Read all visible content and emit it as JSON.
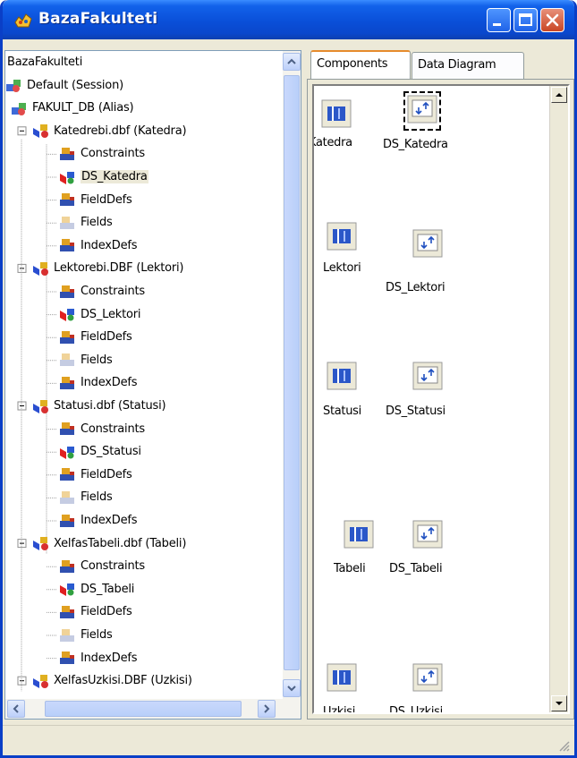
{
  "window": {
    "title": "BazaFakulteti"
  },
  "tree": [
    {
      "label": "BazaFakulteti",
      "level": 0,
      "icon": "none"
    },
    {
      "label": "Default (Session)",
      "level": 0,
      "icon": "session-icon"
    },
    {
      "label": "FAKULT_DB (Alias)",
      "level": 1,
      "icon": "database-icon",
      "expander": "minus"
    },
    {
      "label": "Katedrebi.dbf (Katedra)",
      "level": 2,
      "icon": "table-icon",
      "expander": "minus"
    },
    {
      "label": "Constraints",
      "level": 3,
      "icon": "component-icon"
    },
    {
      "label": "DS_Katedra",
      "level": 3,
      "icon": "datasource-icon",
      "selected": true
    },
    {
      "label": "FieldDefs",
      "level": 3,
      "icon": "component-icon"
    },
    {
      "label": "Fields",
      "level": 3,
      "icon": "component-faded-icon"
    },
    {
      "label": "IndexDefs",
      "level": 3,
      "icon": "component-icon"
    },
    {
      "label": "Lektorebi.DBF (Lektori)",
      "level": 2,
      "icon": "table-icon",
      "expander": "minus"
    },
    {
      "label": "Constraints",
      "level": 3,
      "icon": "component-icon"
    },
    {
      "label": "DS_Lektori",
      "level": 3,
      "icon": "datasource-icon"
    },
    {
      "label": "FieldDefs",
      "level": 3,
      "icon": "component-icon"
    },
    {
      "label": "Fields",
      "level": 3,
      "icon": "component-faded-icon"
    },
    {
      "label": "IndexDefs",
      "level": 3,
      "icon": "component-icon"
    },
    {
      "label": "Statusi.dbf (Statusi)",
      "level": 2,
      "icon": "table-icon",
      "expander": "minus"
    },
    {
      "label": "Constraints",
      "level": 3,
      "icon": "component-icon"
    },
    {
      "label": "DS_Statusi",
      "level": 3,
      "icon": "datasource-icon"
    },
    {
      "label": "FieldDefs",
      "level": 3,
      "icon": "component-icon"
    },
    {
      "label": "Fields",
      "level": 3,
      "icon": "component-faded-icon"
    },
    {
      "label": "IndexDefs",
      "level": 3,
      "icon": "component-icon"
    },
    {
      "label": "XelfasTabeli.dbf (Tabeli)",
      "level": 2,
      "icon": "table-icon",
      "expander": "minus"
    },
    {
      "label": "Constraints",
      "level": 3,
      "icon": "component-icon"
    },
    {
      "label": "DS_Tabeli",
      "level": 3,
      "icon": "datasource-icon"
    },
    {
      "label": "FieldDefs",
      "level": 3,
      "icon": "component-icon"
    },
    {
      "label": "Fields",
      "level": 3,
      "icon": "component-faded-icon"
    },
    {
      "label": "IndexDefs",
      "level": 3,
      "icon": "component-icon"
    },
    {
      "label": "XelfasUzkisi.DBF (Uzkisi)",
      "level": 2,
      "icon": "table-icon",
      "expander": "minus"
    }
  ],
  "tabs": [
    {
      "label": "Components",
      "active": true
    },
    {
      "label": "Data Diagram",
      "active": false
    }
  ],
  "components": [
    {
      "table": "Katedra",
      "datasource": "DS_Katedra",
      "ds_selected": true
    },
    {
      "table": "Lektori",
      "datasource": "DS_Lektori"
    },
    {
      "table": "Statusi",
      "datasource": "DS_Statusi"
    },
    {
      "table": "Tabeli",
      "datasource": "DS_Tabeli"
    },
    {
      "table": "Uzkisi",
      "datasource": "DS_Uzkisi"
    }
  ],
  "colors": {
    "titlebar": "#0a4fd8",
    "selection": "#ece9d8",
    "tab_accent": "#e68b2c"
  }
}
